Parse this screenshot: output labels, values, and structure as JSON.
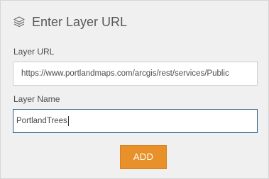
{
  "dialog": {
    "title": "Enter Layer URL",
    "icon": "layers-icon"
  },
  "layer_url": {
    "label": "Layer URL",
    "value": "https://www.portlandmaps.com/arcgis/rest/services/Public"
  },
  "layer_name": {
    "label": "Layer Name",
    "value": "PortlandTrees"
  },
  "actions": {
    "add_label": "ADD"
  },
  "colors": {
    "accent": "#e8912b",
    "panel_background": "#f0f0f0",
    "focus_border": "#2e5f8a"
  }
}
